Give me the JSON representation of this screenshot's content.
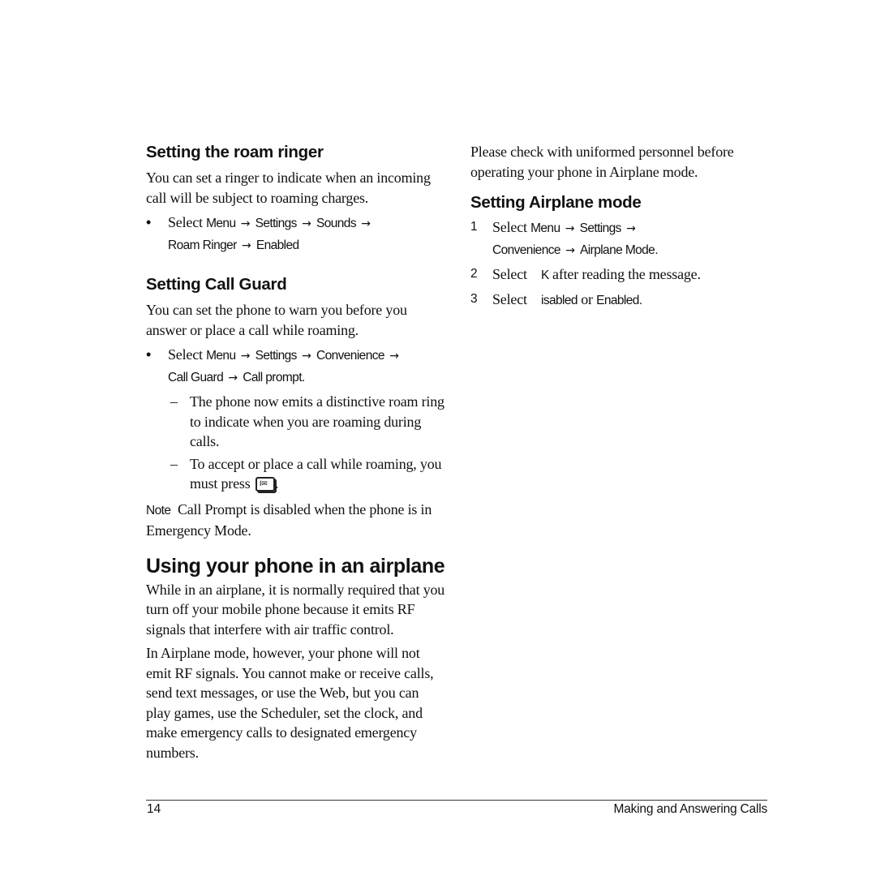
{
  "left": {
    "roam_ringer": {
      "heading": "Setting the roam ringer",
      "body": "You can set a ringer to indicate when an incoming call will be subject to roaming charges.",
      "step": {
        "prefix": "Select ",
        "path": [
          "Menu",
          "Settings",
          "Sounds",
          "Roam Ringer",
          "Enabled"
        ]
      }
    },
    "call_guard": {
      "heading": "Setting Call Guard",
      "body": "You can set the phone to warn you before you answer or place a call while roaming.",
      "step": {
        "prefix": "Select ",
        "path": [
          "Menu",
          "Settings",
          "Convenience",
          "Call Guard",
          "Call prompt."
        ]
      },
      "subitems": [
        "The phone now emits a distinctive roam ring to indicate when you are roaming during calls.",
        "To accept or place a call while roaming, you must press"
      ],
      "key_icon": "send-talk-key-icon",
      "note_label": "Note",
      "note_text": "Call Prompt is disabled when the phone is in Emergency Mode."
    },
    "airplane": {
      "heading": "Using your phone in an airplane",
      "para1": "While in an airplane, it is normally required that you turn off your mobile phone because it emits RF signals that interfere with air traffic control.",
      "para2": "In Airplane mode, however, your phone will not emit RF signals. You cannot make or receive calls, send text messages, or use the Web, but you can play games, use the Scheduler, set the clock, and make emergency calls to designated emergency numbers."
    }
  },
  "right": {
    "intro": "Please check with uniformed personnel before operating your phone in Airplane mode.",
    "heading": "Setting Airplane mode",
    "steps": [
      {
        "num": "1",
        "prefix": "Select ",
        "path": [
          "Menu",
          "Settings",
          "Convenience",
          "Airplane Mode."
        ]
      },
      {
        "num": "2",
        "prefix": "Select ",
        "key": "K",
        "rest": " after reading the message."
      },
      {
        "num": "3",
        "prefix": "Select ",
        "key": "isabled",
        "or": " or ",
        "key2": "Enabled."
      }
    ]
  },
  "footer": {
    "page_number": "14",
    "chapter_title": "Making and Answering Calls"
  },
  "glyphs": {
    "arrow": "→",
    "bullet": "•",
    "dash": "–"
  }
}
